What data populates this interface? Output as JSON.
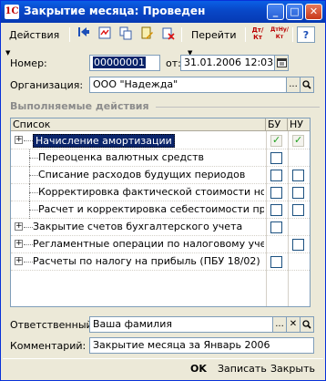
{
  "window": {
    "title": "Закрытие месяца: Проведен",
    "app_icon_glyph": "1С",
    "minimize_glyph": "_",
    "maximize_glyph": "□",
    "close_glyph": "✕"
  },
  "toolbar": {
    "actions_label": "Действия",
    "dropdown_glyph": "▼",
    "goto_label": "Перейти",
    "icons": [
      "go-first-icon",
      "structure-icon",
      "copy-icon",
      "document-edit-icon",
      "movements-dt-kt-icon",
      "movements-dt-kt-nu-icon",
      "help-icon"
    ],
    "dt_kt_glyph": "Дт/Кт",
    "dt_kt_nu_glyph": "ДтНу/Кт",
    "help_glyph": "?"
  },
  "form": {
    "number_label": "Номер:",
    "number_value": "00000001",
    "date_label": "от:",
    "date_value": "31.01.2006 12:03:00",
    "org_label": "Организация:",
    "org_value": "ООО \"Надежда\"",
    "select_glyph": "...",
    "search_glyph": "⚲",
    "clear_glyph": "✕"
  },
  "section": {
    "title": "Выполняемые действия"
  },
  "grid": {
    "columns": [
      "Список",
      "БУ",
      "НУ"
    ],
    "rows": [
      {
        "label": "Начисление амортизации",
        "expandable": true,
        "level": 0,
        "bu": true,
        "nu": true,
        "bu_enabled": false,
        "nu_enabled": false,
        "selected": true
      },
      {
        "label": "Переоценка валютных средств",
        "expandable": false,
        "level": 1,
        "bu": false,
        "nu": null
      },
      {
        "label": "Списание расходов будущих периодов",
        "expandable": false,
        "level": 1,
        "bu": false,
        "nu": false
      },
      {
        "label": "Корректировка фактической стоимости номен...",
        "expandable": false,
        "level": 1,
        "bu": false,
        "nu": false
      },
      {
        "label": "Расчет и корректировка себестоимости продук...",
        "expandable": false,
        "level": 1,
        "bu": false,
        "nu": false
      },
      {
        "label": "Закрытие счетов бухгалтерского учета",
        "expandable": true,
        "level": 0,
        "bu": false,
        "nu": null
      },
      {
        "label": "Регламентные операции по налоговому учету",
        "expandable": true,
        "level": 0,
        "bu": null,
        "nu": false
      },
      {
        "label": "Расчеты по налогу на прибыль (ПБУ 18/02)",
        "expandable": true,
        "level": 0,
        "bu": false,
        "nu": null
      }
    ]
  },
  "footer": {
    "responsible_label": "Ответственный:",
    "responsible_value": "Ваша фамилия",
    "comment_label": "Комментарий:",
    "comment_value": "Закрытие месяца за Январь 2006",
    "ok_label": "OK",
    "save_label": "Записать",
    "close_label": "Закрыть"
  },
  "colors": {
    "titlebar": "#0847c7",
    "selection": "#0a246a",
    "checkmark": "#21a121",
    "window_bg": "#ece9d8"
  }
}
